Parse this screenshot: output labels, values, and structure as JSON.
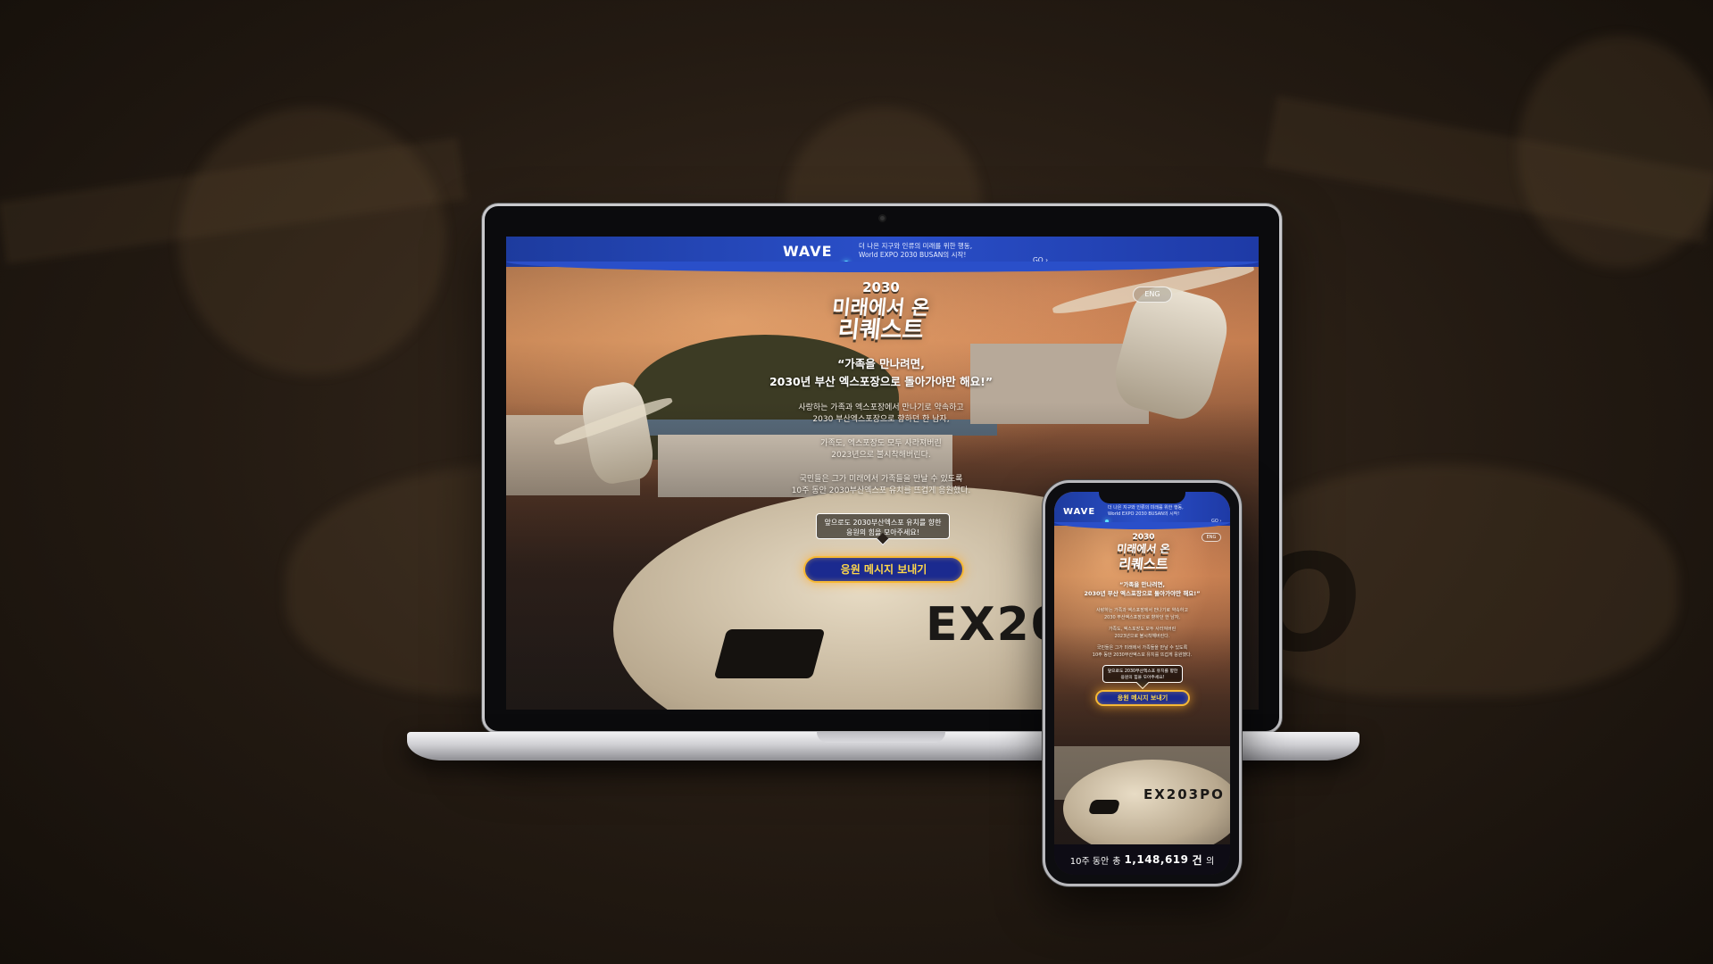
{
  "site": {
    "brand": "WAVE",
    "banner_line1": "더 나은 지구와 인류의 미래를 위한 행동,",
    "banner_line2": "World EXPO 2030 BUSAN의 시작!",
    "go_label": "GO ›",
    "lang_button": "ENG",
    "logo_year": "2030",
    "logo_line1": "미래에서 온",
    "logo_line2": "리퀘스트",
    "quote_line1": "“가족을 만나려면,",
    "quote_line2": "2030년 부산 엑스포장으로 돌아가야만 해요!”",
    "para1_line1": "사랑하는 가족과 엑스포장에서 만나기로 약속하고",
    "para1_line2": "2030 부산엑스포장으로 향하던 한 남자,",
    "para2_line1": "가족도, 엑스포장도 모두 사라져버린",
    "para2_line2": "2023년으로 불시착해버린다.",
    "para3_line1": "국민들은 그가 미래에서 가족들을 만날 수 있도록",
    "para3_line2": "10주 동안 2030부산엑스포 유치를 뜨겁게 응원했다.",
    "bubble_line1": "앞으로도 2030부산엑스포 유치를 향한",
    "bubble_line2": "응원의 힘을 모아주세요!",
    "cta_label": "응원 메시지 보내기",
    "aircraft_registration": "EX203P",
    "phone_aircraft_registration": "EX203PO",
    "footer_prefix": "10주 동안",
    "footer_total": "총",
    "footer_count": "1,148,619",
    "footer_unit": "건",
    "footer_suffix": "의"
  },
  "background": {
    "aircraft_text": "PO"
  },
  "colors": {
    "topbar": "#2a4fc9",
    "cta_border": "#f6b935",
    "cta_text": "#ffd84a",
    "cta_fill": "#1b2a8f"
  }
}
